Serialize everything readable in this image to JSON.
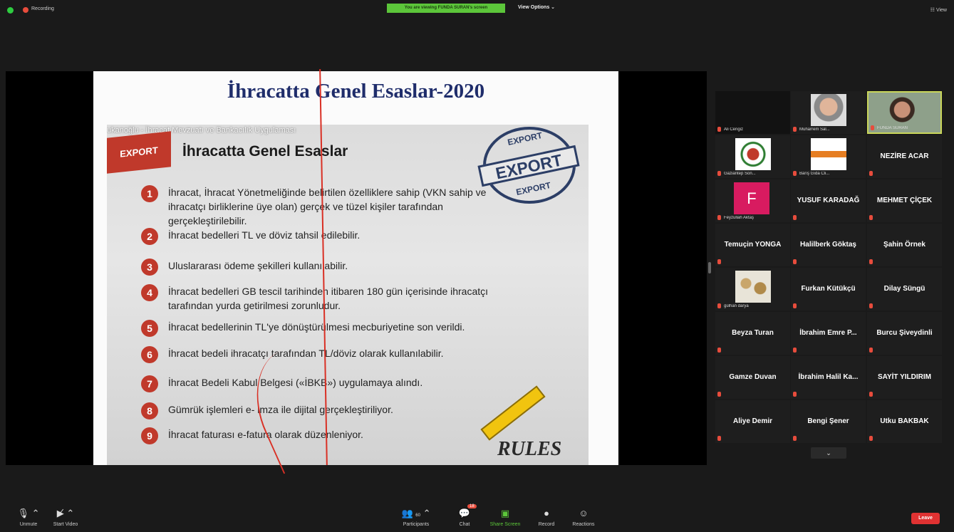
{
  "topbar": {
    "recording": "Recording",
    "viewing_banner": "You are viewing FUNDA SURAN's screen",
    "view_options": "View Options ⌄",
    "view": "☷ View"
  },
  "slide": {
    "title": "İhracatta Genel Esaslar-2020",
    "photo_caption": "ukanoğlu - İhracat Mevzuatı ve Bankacılık Uygulaması",
    "ribbon": "EXPORT",
    "heading": "İhracatta Genel Esaslar",
    "stamp_top": "EXPORT",
    "stamp_main": "EXPORT",
    "stamp_bottom": "EXPORT",
    "items": [
      {
        "num": "1",
        "text": "İhracat, İhracat Yönetmeliğinde belirtilen özelliklere sahip (VKN sahip ve ihracatçı birliklerine üye olan) gerçek ve tüzel kişiler tarafından gerçekleştirilebilir."
      },
      {
        "num": "2",
        "text": "İhracat bedelleri TL ve döviz tahsil edilebilir."
      },
      {
        "num": "3",
        "text": "Uluslararası ödeme şekilleri kullanılabilir."
      },
      {
        "num": "4",
        "text": "İhracat bedelleri GB tescil tarihinden itibaren 180 gün içerisinde ihracatçı tarafından yurda getirilmesi zorunludur."
      },
      {
        "num": "5",
        "text": "İhracat bedellerinin TL'ye dönüştürülmesi mecburiyetine son verildi."
      },
      {
        "num": "6",
        "text": "İhracat bedeli ihracatçı tarafından TL/döviz olarak kullanılabilir."
      },
      {
        "num": "7",
        "text": "İhracat Bedeli Kabul Belgesi («İBKB») uygulamaya alındı."
      },
      {
        "num": "8",
        "text": "Gümrük işlemleri e- imza ile dijital gerçekleştiriliyor."
      },
      {
        "num": "9",
        "text": "İhracat faturası e-fatura olarak düzenleniyor."
      }
    ],
    "rules": "RULES"
  },
  "gallery": {
    "tiles": [
      {
        "name": "Ali Cengiz",
        "style": "video-dark"
      },
      {
        "name": "Muharrem Sal...",
        "style": "video-man"
      },
      {
        "name": "FUNDA SURAN",
        "style": "video-woman",
        "active": true
      },
      {
        "name": "Gaziantep Son...",
        "style": "logo"
      },
      {
        "name": "Barış Gıda Cli...",
        "style": "logo-orange"
      },
      {
        "name": "NEZİRE ACAR",
        "style": "name"
      },
      {
        "name": "Feyzullah Aktaş",
        "style": "letter",
        "letter": "F"
      },
      {
        "name": "YUSUF KARADAĞ",
        "style": "name"
      },
      {
        "name": "MEHMET ÇİÇEK",
        "style": "name"
      },
      {
        "name": "Temuçin YONGA",
        "style": "name"
      },
      {
        "name": "Halilberk Göktaş",
        "style": "name"
      },
      {
        "name": "Şahin Örnek",
        "style": "name"
      },
      {
        "name": "gülhan darya",
        "style": "photo"
      },
      {
        "name": "Furkan Kütükçü",
        "style": "name"
      },
      {
        "name": "Dilay Süngü",
        "style": "name"
      },
      {
        "name": "Beyza Turan",
        "style": "name"
      },
      {
        "name": "İbrahim Emre P...",
        "style": "name"
      },
      {
        "name": "Burcu Şiveydinli",
        "style": "name"
      },
      {
        "name": "Gamze Duvan",
        "style": "name"
      },
      {
        "name": "İbrahim Halil Ka...",
        "style": "name"
      },
      {
        "name": "SAYİT YILDIRIM",
        "style": "name"
      },
      {
        "name": "Aliye Demir",
        "style": "name"
      },
      {
        "name": "Bengi Şener",
        "style": "name"
      },
      {
        "name": "Utku BAKBAK",
        "style": "name"
      }
    ],
    "next_page": "⌄"
  },
  "toolbar": {
    "unmute": "Unmute",
    "start_video": "Start Video",
    "participants": "Participants",
    "participants_count": "60",
    "chat": "Chat",
    "chat_badge": "18",
    "share_screen": "Share Screen",
    "record": "Record",
    "reactions": "Reactions",
    "leave": "Leave"
  },
  "colors": {
    "banner_green": "#5cc63a",
    "leave_red": "#e03232",
    "slide_title": "#1f2d6b",
    "number_badge": "#c0392b",
    "annotation": "#d93025"
  }
}
